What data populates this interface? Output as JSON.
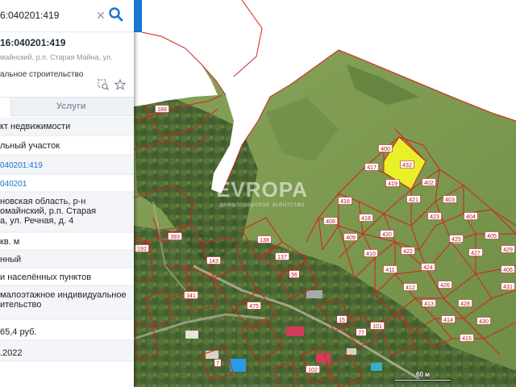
{
  "search": {
    "value": "6:040201:419"
  },
  "card": {
    "title": "16:040201:419",
    "address_line": "майнский, р.п. Старая Майна, ул.",
    "use_line": "альное строительство"
  },
  "tabs": {
    "services_label": "Услуги"
  },
  "rows": [
    "кт недвижимости",
    "льный участок",
    "040201:419",
    "040201",
    "новская область, р-н\nомайнский, р.п. Старая\nа, ул. Речная, д. 4",
    "кв. м",
    "нный",
    "и населённых пунктов",
    "малоэтажное индивидуальное\nительство",
    "65,4 руб.",
    ".2022"
  ],
  "watermark": {
    "title": "EVROPA",
    "subtitle": "девелоперское агентство"
  },
  "scale": {
    "label": "60 м"
  },
  "colors": {
    "plot_border": "#d81f1f",
    "selected_plot": "#e8f02a",
    "accent": "#1976d2",
    "link": "#1a73c9"
  },
  "plots": [
    {
      "label": "188"
    },
    {
      "label": "400"
    },
    {
      "label": "417"
    },
    {
      "label": "432"
    },
    {
      "label": "419"
    },
    {
      "label": "402"
    },
    {
      "label": "421"
    },
    {
      "label": "403"
    },
    {
      "label": "416"
    },
    {
      "label": "418"
    },
    {
      "label": "423"
    },
    {
      "label": "404"
    },
    {
      "label": "408"
    },
    {
      "label": "409"
    },
    {
      "label": "420"
    },
    {
      "label": "425"
    },
    {
      "label": "405"
    },
    {
      "label": "410"
    },
    {
      "label": "422"
    },
    {
      "label": "427"
    },
    {
      "label": "429"
    },
    {
      "label": "411"
    },
    {
      "label": "424"
    },
    {
      "label": "406"
    },
    {
      "label": "412"
    },
    {
      "label": "426"
    },
    {
      "label": "431"
    },
    {
      "label": "413"
    },
    {
      "label": "428"
    },
    {
      "label": "414"
    },
    {
      "label": "430"
    },
    {
      "label": "415"
    },
    {
      "label": "192"
    },
    {
      "label": "393"
    },
    {
      "label": "138"
    },
    {
      "label": "137"
    },
    {
      "label": "143"
    },
    {
      "label": "56"
    },
    {
      "label": "341"
    },
    {
      "label": "475"
    },
    {
      "label": "15"
    },
    {
      "label": "77"
    },
    {
      "label": "101"
    },
    {
      "label": "102"
    },
    {
      "label": "7"
    }
  ]
}
